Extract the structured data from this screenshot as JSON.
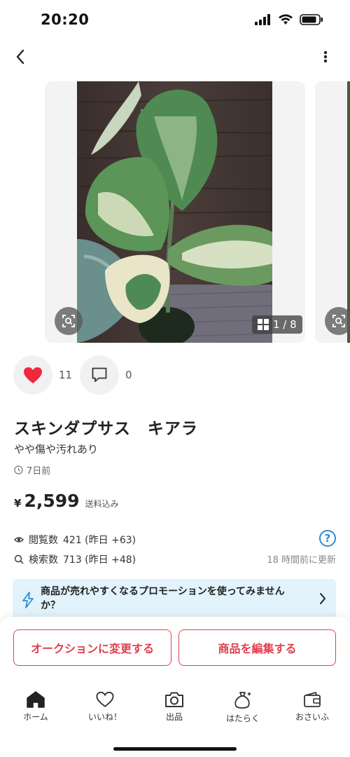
{
  "status_bar": {
    "time": "20:20"
  },
  "gallery": {
    "counter": "1 / 8"
  },
  "actions": {
    "likes": "11",
    "comments": "0"
  },
  "item": {
    "title": "スキンダプサス　キアラ",
    "condition": "やや傷や汚れあり",
    "posted": "7日前",
    "price_symbol": "¥",
    "price": "2,599",
    "shipping": "送料込み"
  },
  "stats": {
    "views_label": "閲覧数",
    "views_value": "421 (昨日 +63)",
    "search_label": "検索数",
    "search_value": "713 (昨日 +48)",
    "help": "?",
    "updated": "18 時間前に更新"
  },
  "promo": {
    "text": "商品が売れやすくなるプロモーションを使ってみませんか？"
  },
  "buttons": {
    "auction": "オークションに変更する",
    "edit": "商品を編集する"
  },
  "tabs": [
    {
      "label": "ホーム",
      "icon": "home-icon"
    },
    {
      "label": "いいね！",
      "icon": "heart-icon"
    },
    {
      "label": "出品",
      "icon": "camera-icon"
    },
    {
      "label": "はたらく",
      "icon": "money-bag-icon"
    },
    {
      "label": "おさいふ",
      "icon": "wallet-icon"
    }
  ],
  "colors": {
    "accent": "#e0404e",
    "like": "#f0283c",
    "help": "#2a8bd8",
    "promo_bg": "#e3f3fb"
  }
}
